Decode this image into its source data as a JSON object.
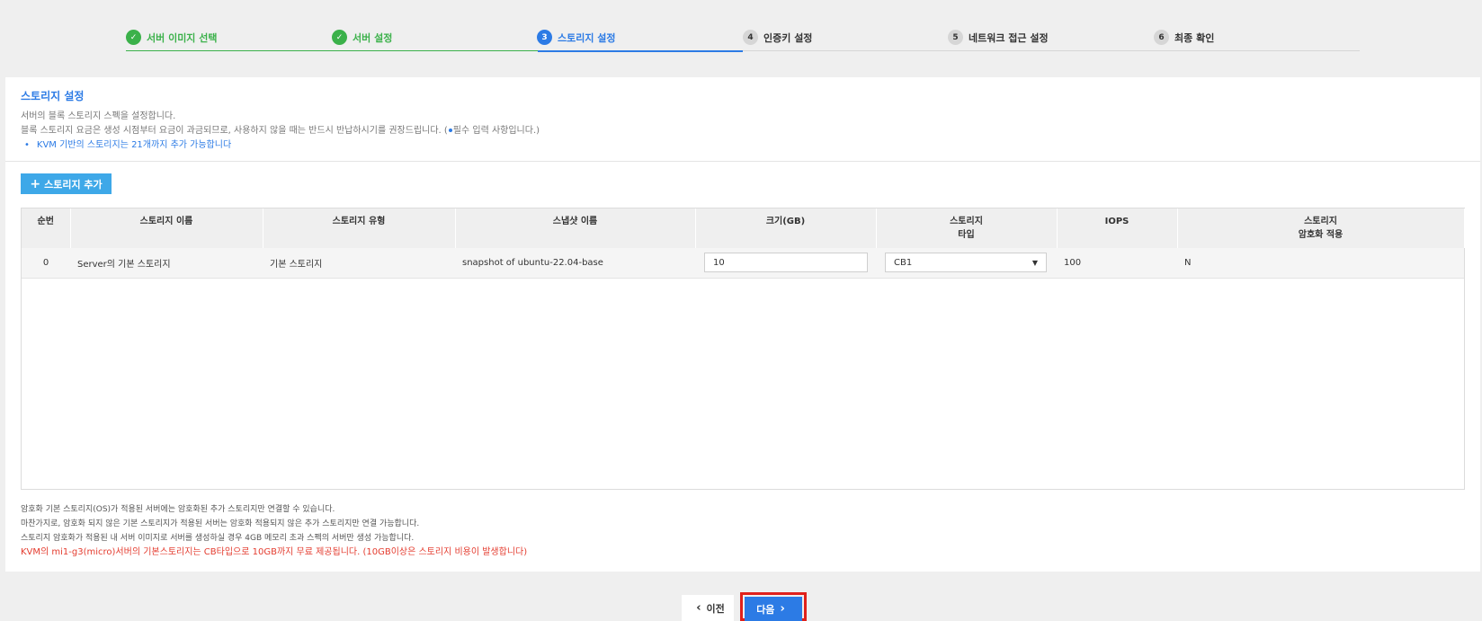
{
  "stepper": {
    "steps": [
      {
        "num": "✓",
        "label": "서버 이미지 선택",
        "state": "done"
      },
      {
        "num": "✓",
        "label": "서버 설정",
        "state": "done"
      },
      {
        "num": "3",
        "label": "스토리지 설정",
        "state": "active"
      },
      {
        "num": "4",
        "label": "인증키 설정",
        "state": "todo"
      },
      {
        "num": "5",
        "label": "네트워크 접근 설정",
        "state": "todo"
      },
      {
        "num": "6",
        "label": "최종 확인",
        "state": "todo"
      }
    ]
  },
  "panel": {
    "title": "스토리지 설정",
    "desc1": "서버의 블록 스토리지 스펙을 설정합니다.",
    "desc2_a": "블록 스토리지 요금은 생성 시점부터 요금이 과금되므로, 사용하지 않을 때는 반드시 반납하시기를 권장드립니다. (",
    "desc2_b": "필수 입력 사항입니다.)",
    "kvm_note": "KVM 기반의 스토리지는 21개까지 추가 가능합니다",
    "add_button": "스토리지 추가"
  },
  "table": {
    "headers": {
      "seq": "순번",
      "name": "스토리지 이름",
      "type": "스토리지 유형",
      "snapshot": "스냅샷 이름",
      "size": "크기(GB)",
      "stype_1": "스토리지",
      "stype_2": "타입",
      "iops": "IOPS",
      "enc_1": "스토리지",
      "enc_2": "암호화 적용"
    },
    "rows": [
      {
        "seq": "0",
        "name": "Server의 기본 스토리지",
        "type": "기본 스토리지",
        "snapshot": "snapshot of ubuntu-22.04-base",
        "size": "10",
        "storage_type": "CB1",
        "iops": "100",
        "encryption": "N"
      }
    ]
  },
  "notes": {
    "line1": "암호화 기본 스토리지(OS)가 적용된 서버에는 암호화된 추가 스토리지만 연결할 수 있습니다.",
    "line2": "마찬가지로, 암호화 되지 않은 기본 스토리지가 적용된 서버는 암호화 적용되지 않은 추가 스토리지만 연결 가능합니다.",
    "line3": "스토리지 암호화가 적용된 내 서버 이미지로 서버를 생성하실 경우 4GB 메모리 초과 스펙의 서버만 생성 가능합니다.",
    "red": "KVM의 mi1-g3(micro)서버의 기본스토리지는 CB타입으로 10GB까지 무료 제공됩니다. (10GB이상은 스토리지 비용이 발생합니다)"
  },
  "footer": {
    "prev": "이전",
    "next": "다음"
  },
  "colors": {
    "done": "#3bb14a",
    "active": "#2c7be5",
    "add_button": "#3ea8e8",
    "highlight": "#e0211b",
    "warning_text": "#e43c2f"
  }
}
